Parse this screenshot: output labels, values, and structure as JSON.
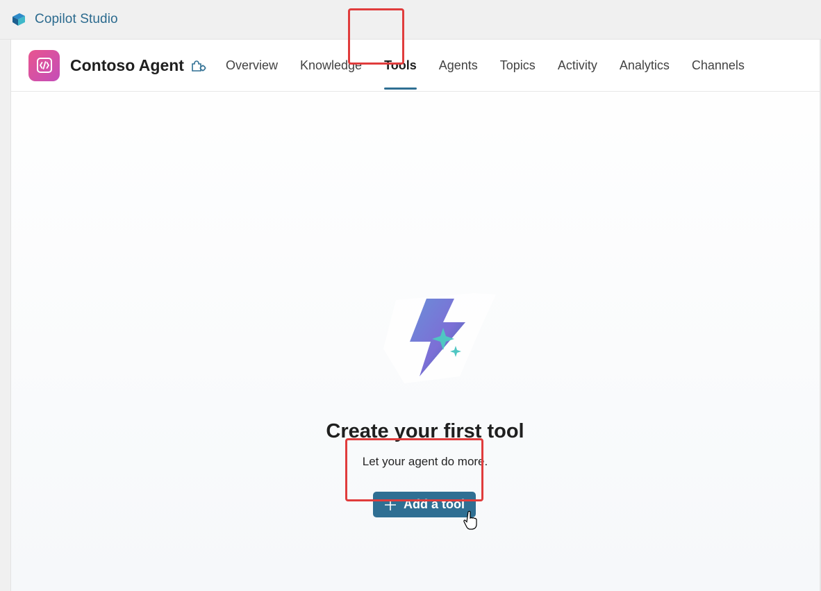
{
  "app": {
    "title": "Copilot Studio",
    "logo_icon": "copilot-studio-logo"
  },
  "header": {
    "agent_name": "Contoso Agent",
    "agent_icon": "code-brackets-icon",
    "settings_icon": "agent-settings-icon",
    "tabs": [
      {
        "label": "Overview",
        "active": false
      },
      {
        "label": "Knowledge",
        "active": false
      },
      {
        "label": "Tools",
        "active": true
      },
      {
        "label": "Agents",
        "active": false
      },
      {
        "label": "Topics",
        "active": false
      },
      {
        "label": "Activity",
        "active": false
      },
      {
        "label": "Analytics",
        "active": false
      },
      {
        "label": "Channels",
        "active": false
      }
    ]
  },
  "empty_state": {
    "illustration_icon": "lightning-sparkle-icon",
    "title": "Create your first tool",
    "subtitle": "Let your agent do more.",
    "button_label": "Add a tool",
    "button_icon": "plus-icon"
  },
  "colors": {
    "accent": "#2f6f93",
    "highlight": "#e03c3c",
    "agent_gradient_start": "#e8558f",
    "agent_gradient_end": "#c44db8"
  }
}
